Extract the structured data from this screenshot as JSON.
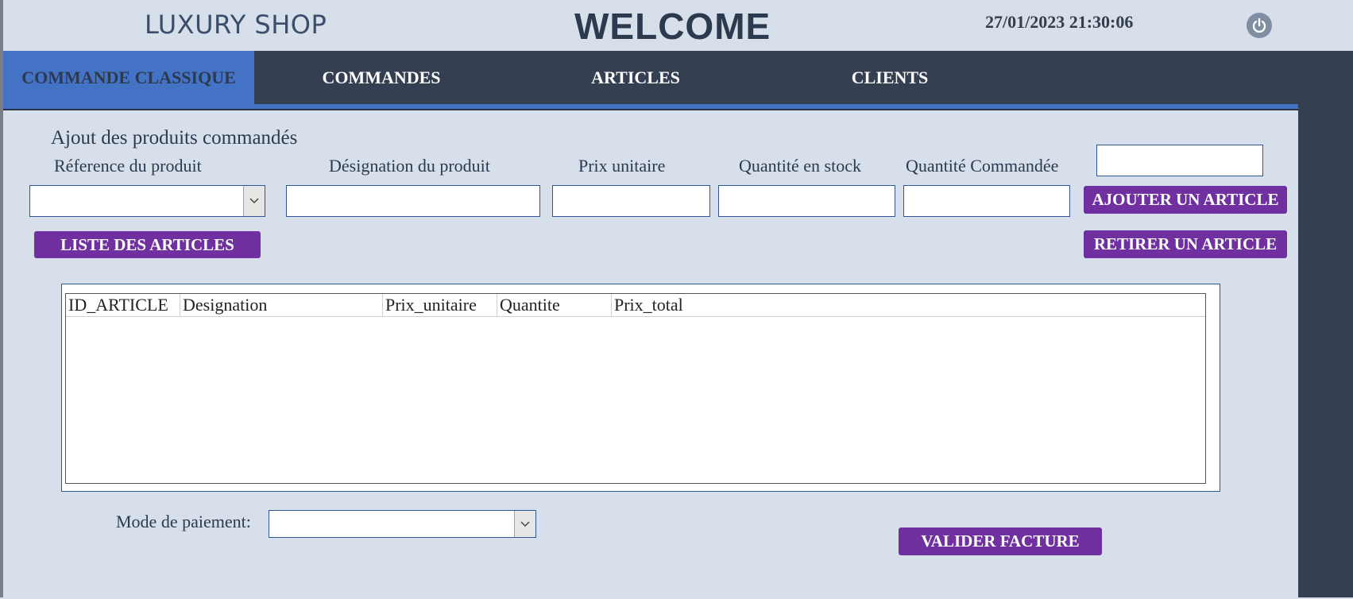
{
  "header": {
    "brand": "LUXURY SHOP",
    "welcome": "WELCOME",
    "datetime": "27/01/2023 21:30:06",
    "power_icon": "power-icon"
  },
  "nav": {
    "tabs": [
      {
        "label": "COMMANDE CLASSIQUE",
        "active": true
      },
      {
        "label": "COMMANDES",
        "active": false
      },
      {
        "label": "ARTICLES",
        "active": false
      },
      {
        "label": "CLIENTS",
        "active": false
      }
    ]
  },
  "form": {
    "section_title": "Ajout des produits commandés",
    "labels": {
      "reference": "Réference du produit",
      "designation": "Désignation du produit",
      "prix_unitaire": "Prix unitaire",
      "quantite_stock": "Quantité en stock",
      "quantite_commandee": "Quantité Commandée"
    },
    "values": {
      "reference": "",
      "designation": "",
      "prix_unitaire": "",
      "quantite_stock": "",
      "quantite_commandee": "",
      "extra": ""
    },
    "buttons": {
      "liste_articles": "LISTE DES ARTICLES",
      "ajouter_article": "AJOUTER UN ARTICLE",
      "retirer_article": "RETIRER UN ARTICLE",
      "valider_facture": "VALIDER FACTURE"
    },
    "paiement_label": "Mode de paiement:",
    "paiement_value": ""
  },
  "table": {
    "columns": [
      "ID_ARTICLE",
      "Designation",
      "Prix_unitaire",
      "Quantite",
      "Prix_total"
    ],
    "rows": []
  },
  "colors": {
    "background": "#d6dfea",
    "navbar": "#343f52",
    "accent_blue": "#4472c4",
    "button_purple": "#7030a0"
  }
}
